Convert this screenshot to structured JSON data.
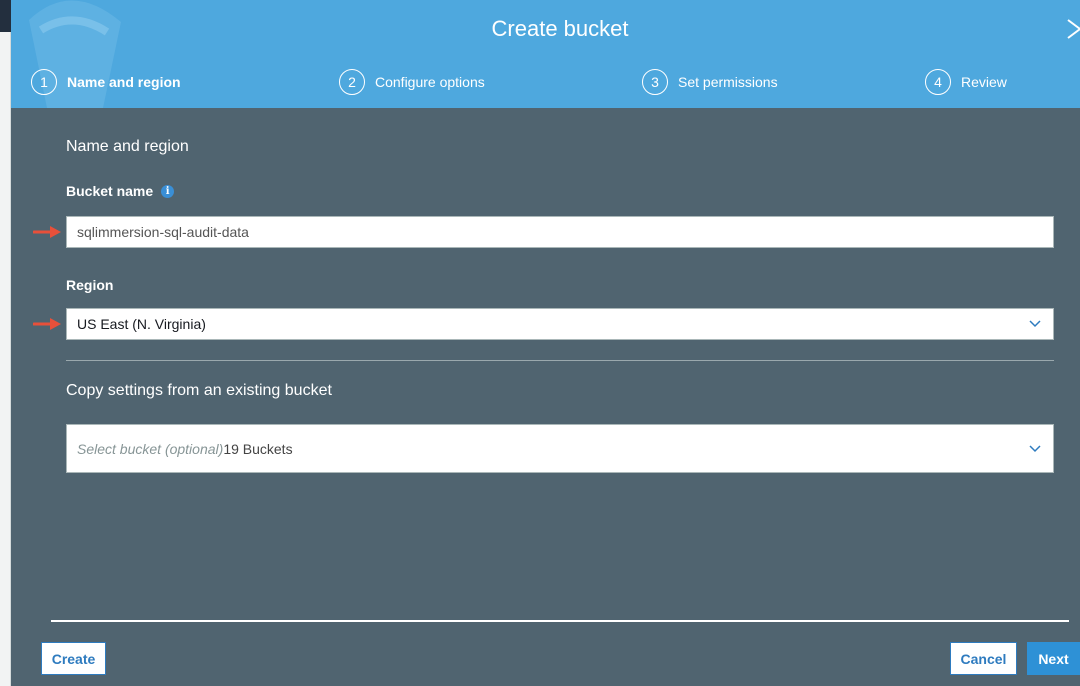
{
  "dialog": {
    "title": "Create bucket"
  },
  "steps": [
    {
      "num": "1",
      "label": "Name and region",
      "active": true
    },
    {
      "num": "2",
      "label": "Configure options",
      "active": false
    },
    {
      "num": "3",
      "label": "Set permissions",
      "active": false
    },
    {
      "num": "4",
      "label": "Review",
      "active": false
    }
  ],
  "form": {
    "section_title": "Name and region",
    "bucket_name_label": "Bucket name",
    "bucket_name_value": "sqlimmersion-sql-audit-data",
    "region_label": "Region",
    "region_value": "US East (N. Virginia)",
    "copy_settings_title": "Copy settings from an existing bucket",
    "copy_placeholder": "Select bucket (optional)",
    "copy_count": "19 Buckets"
  },
  "footer": {
    "create_label": "Create",
    "cancel_label": "Cancel",
    "next_label": "Next"
  },
  "icons": {
    "info": "info-icon",
    "close": "close-icon",
    "chevron": "chevron-down-icon",
    "arrow": "red-arrow-icon"
  },
  "colors": {
    "header": "#4ea8de",
    "body": "#506470",
    "primary_button": "#2e91d6",
    "arrow": "#e8503a"
  }
}
